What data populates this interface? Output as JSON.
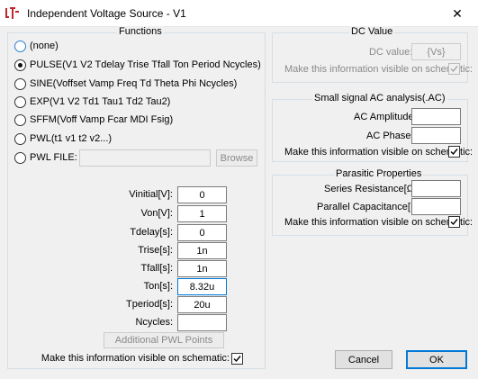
{
  "window": {
    "title": "Independent Voltage Source - V1",
    "close_glyph": "✕"
  },
  "functions": {
    "group_title": "Functions",
    "options": [
      {
        "label": "(none)",
        "checked": false
      },
      {
        "label": "PULSE(V1 V2 Tdelay Trise Tfall Ton Period Ncycles)",
        "checked": true
      },
      {
        "label": "SINE(Voffset Vamp Freq Td Theta Phi Ncycles)",
        "checked": false
      },
      {
        "label": "EXP(V1 V2 Td1 Tau1 Td2 Tau2)",
        "checked": false
      },
      {
        "label": "SFFM(Voff Vamp Fcar MDI Fsig)",
        "checked": false
      },
      {
        "label": "PWL(t1 v1 t2 v2...)",
        "checked": false
      },
      {
        "label": "PWL FILE:",
        "checked": false
      }
    ],
    "pwl_file_value": "",
    "browse_label": "Browse",
    "params": [
      {
        "label": "Vinitial[V]:",
        "value": "0"
      },
      {
        "label": "Von[V]:",
        "value": "1"
      },
      {
        "label": "Tdelay[s]:",
        "value": "0"
      },
      {
        "label": "Trise[s]:",
        "value": "1n"
      },
      {
        "label": "Tfall[s]:",
        "value": "1n"
      },
      {
        "label": "Ton[s]:",
        "value": "8.32u"
      },
      {
        "label": "Tperiod[s]:",
        "value": "20u"
      },
      {
        "label": "Ncycles:",
        "value": ""
      }
    ],
    "additional_pwl_label": "Additional PWL Points",
    "visible_label": "Make this information visible on schematic:",
    "visible_checked": true
  },
  "dc_value": {
    "group_title": "DC Value",
    "label": "DC value:",
    "value": "{Vs}",
    "visible_label": "Make this information visible on schematic:",
    "visible_checked": true
  },
  "ac_analysis": {
    "group_title": "Small signal AC analysis(.AC)",
    "amplitude_label": "AC Amplitude:",
    "amplitude_value": "",
    "phase_label": "AC Phase:",
    "phase_value": "",
    "visible_label": "Make this information visible on schematic:",
    "visible_checked": true
  },
  "parasitic": {
    "group_title": "Parasitic Properties",
    "series_label": "Series Resistance[Ω]:",
    "series_value": "",
    "parallel_label": "Parallel Capacitance[F]:",
    "parallel_value": "",
    "visible_label": "Make this information visible on schematic:",
    "visible_checked": true
  },
  "buttons": {
    "cancel": "Cancel",
    "ok": "OK"
  },
  "colors": {
    "accent": "#0078d7",
    "dialog_bg": "#f0f0f0"
  }
}
